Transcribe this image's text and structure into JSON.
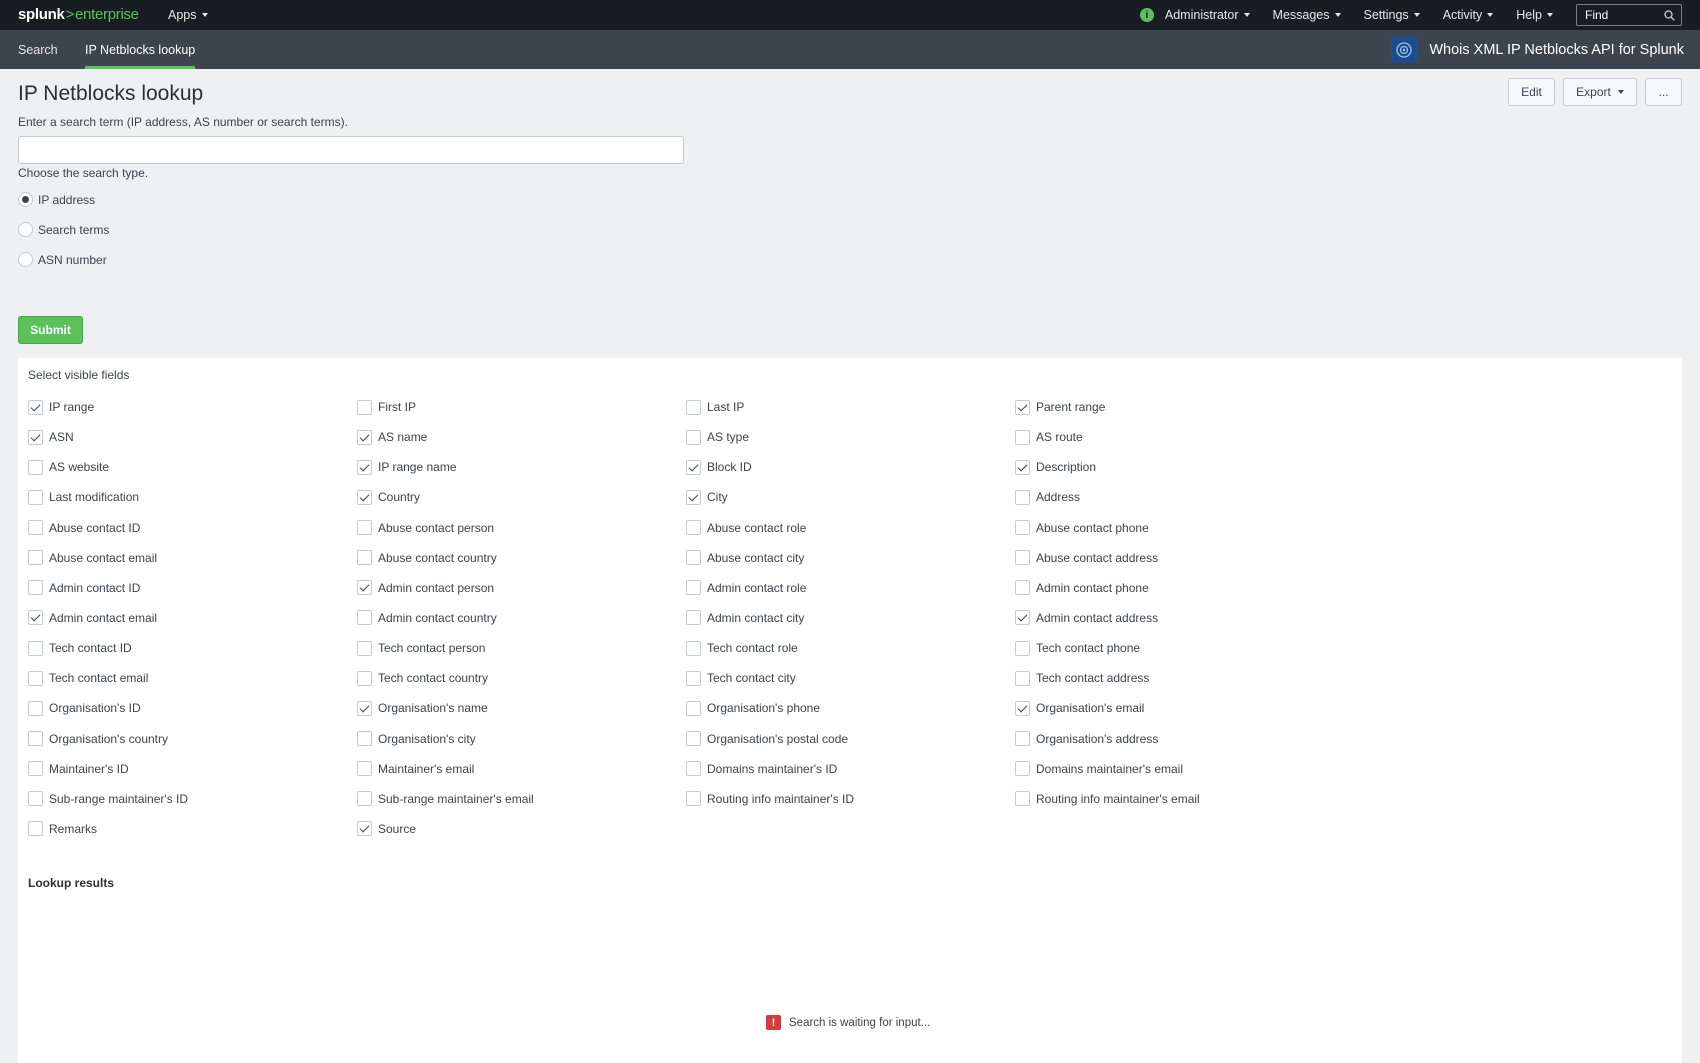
{
  "topbar": {
    "logo_main": "splunk",
    "logo_sep": ">",
    "logo_product": "enterprise",
    "apps_label": "Apps",
    "info_icon": "i",
    "menus": [
      "Administrator",
      "Messages",
      "Settings",
      "Activity",
      "Help"
    ],
    "find_placeholder": "Find"
  },
  "appbar": {
    "tabs": [
      "Search",
      "IP Netblocks lookup"
    ],
    "active_tab": "IP Netblocks lookup",
    "app_title": "Whois XML IP Netblocks API for Splunk",
    "accent_color": "#5cc05c"
  },
  "page": {
    "title": "IP Netblocks lookup",
    "description": "Enter a search term (IP address, AS number or search terms).",
    "buttons": {
      "edit": "Edit",
      "export": "Export",
      "more": "..."
    },
    "search_value": "",
    "type_label": "Choose the search type.",
    "radio_options": [
      "IP address",
      "Search terms",
      "ASN number"
    ],
    "selected_radio": "IP address",
    "submit_label": "Submit"
  },
  "panel": {
    "label": "Select visible fields",
    "fields": [
      {
        "label": "IP range",
        "checked": true
      },
      {
        "label": "First IP",
        "checked": false
      },
      {
        "label": "Last IP",
        "checked": false
      },
      {
        "label": "Parent range",
        "checked": true
      },
      {
        "label": "ASN",
        "checked": true
      },
      {
        "label": "AS name",
        "checked": true
      },
      {
        "label": "AS type",
        "checked": false
      },
      {
        "label": "AS route",
        "checked": false
      },
      {
        "label": "AS website",
        "checked": false
      },
      {
        "label": "IP range name",
        "checked": true
      },
      {
        "label": "Block ID",
        "checked": true
      },
      {
        "label": "Description",
        "checked": true
      },
      {
        "label": "Last modification",
        "checked": false
      },
      {
        "label": "Country",
        "checked": true
      },
      {
        "label": "City",
        "checked": true
      },
      {
        "label": "Address",
        "checked": false
      },
      {
        "label": "Abuse contact ID",
        "checked": false
      },
      {
        "label": "Abuse contact person",
        "checked": false
      },
      {
        "label": "Abuse contact role",
        "checked": false
      },
      {
        "label": "Abuse contact phone",
        "checked": false
      },
      {
        "label": "Abuse contact email",
        "checked": false
      },
      {
        "label": "Abuse contact country",
        "checked": false
      },
      {
        "label": "Abuse contact city",
        "checked": false
      },
      {
        "label": "Abuse contact address",
        "checked": false
      },
      {
        "label": "Admin contact ID",
        "checked": false
      },
      {
        "label": "Admin contact person",
        "checked": true
      },
      {
        "label": "Admin contact role",
        "checked": false
      },
      {
        "label": "Admin contact phone",
        "checked": false
      },
      {
        "label": "Admin contact email",
        "checked": true
      },
      {
        "label": "Admin contact country",
        "checked": false
      },
      {
        "label": "Admin contact city",
        "checked": false
      },
      {
        "label": "Admin contact address",
        "checked": true
      },
      {
        "label": "Tech contact ID",
        "checked": false
      },
      {
        "label": "Tech contact person",
        "checked": false
      },
      {
        "label": "Tech contact role",
        "checked": false
      },
      {
        "label": "Tech contact phone",
        "checked": false
      },
      {
        "label": "Tech contact email",
        "checked": false
      },
      {
        "label": "Tech contact country",
        "checked": false
      },
      {
        "label": "Tech contact city",
        "checked": false
      },
      {
        "label": "Tech contact address",
        "checked": false
      },
      {
        "label": "Organisation's ID",
        "checked": false
      },
      {
        "label": "Organisation's name",
        "checked": true
      },
      {
        "label": "Organisation's phone",
        "checked": false
      },
      {
        "label": "Organisation's email",
        "checked": true
      },
      {
        "label": "Organisation's country",
        "checked": false
      },
      {
        "label": "Organisation's city",
        "checked": false
      },
      {
        "label": "Organisation's postal code",
        "checked": false
      },
      {
        "label": "Organisation's address",
        "checked": false
      },
      {
        "label": "Maintainer's ID",
        "checked": false
      },
      {
        "label": "Maintainer's email",
        "checked": false
      },
      {
        "label": "Domains maintainer's ID",
        "checked": false
      },
      {
        "label": "Domains maintainer's email",
        "checked": false
      },
      {
        "label": "Sub-range maintainer's ID",
        "checked": false
      },
      {
        "label": "Sub-range maintainer's email",
        "checked": false
      },
      {
        "label": "Routing info maintainer's ID",
        "checked": false
      },
      {
        "label": "Routing info maintainer's email",
        "checked": false
      },
      {
        "label": "Remarks",
        "checked": false
      },
      {
        "label": "Source",
        "checked": true
      }
    ],
    "results_title": "Lookup results",
    "waiting_icon": "!",
    "waiting_message": "Search is waiting for input..."
  }
}
